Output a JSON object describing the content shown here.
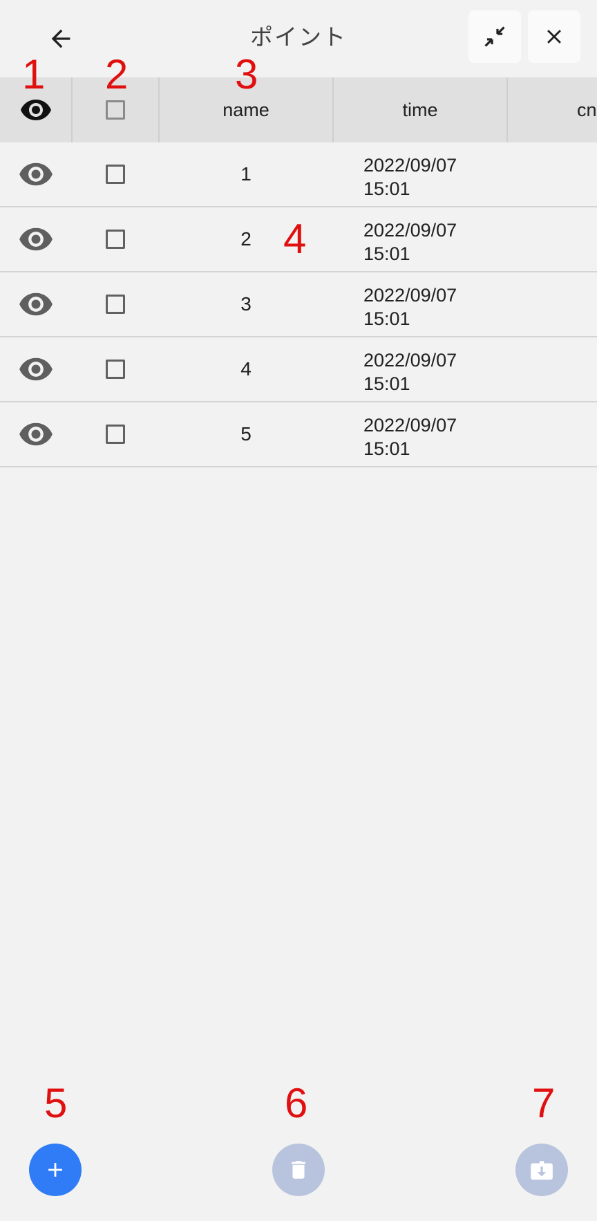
{
  "header": {
    "title": "ポイント"
  },
  "table": {
    "columns": [
      "name",
      "time",
      "cn"
    ],
    "rows": [
      {
        "name": "1",
        "date": "2022/09/07",
        "time": "15:01"
      },
      {
        "name": "2",
        "date": "2022/09/07",
        "time": "15:01"
      },
      {
        "name": "3",
        "date": "2022/09/07",
        "time": "15:01"
      },
      {
        "name": "4",
        "date": "2022/09/07",
        "time": "15:01"
      },
      {
        "name": "5",
        "date": "2022/09/07",
        "time": "15:01"
      }
    ]
  },
  "markers": [
    "1",
    "2",
    "3",
    "4",
    "5",
    "6",
    "7"
  ],
  "icons": {
    "back": "arrow-left-icon",
    "shrink": "collapse-icon",
    "close": "close-icon",
    "eye": "eye-icon",
    "add": "plus-icon",
    "delete": "trash-icon",
    "export": "briefcase-download-icon"
  },
  "colors": {
    "accent": "#2f7cf6",
    "disabled_fab": "#b8c4dd",
    "marker": "#e01010",
    "header_bg": "#e0e0e0"
  }
}
